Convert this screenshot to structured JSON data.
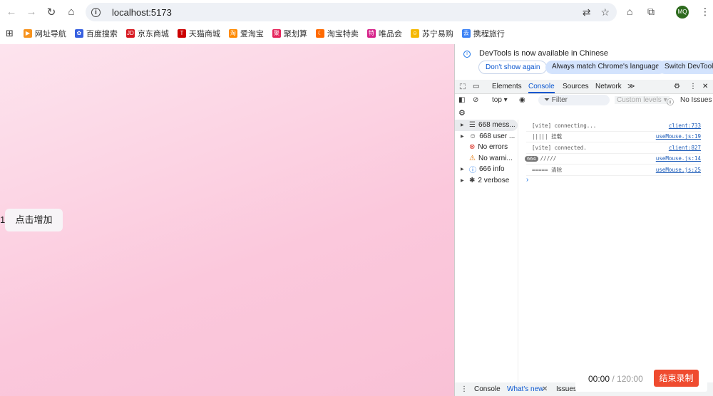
{
  "browser": {
    "url": "localhost:5173",
    "avatar": "MQ"
  },
  "bookmarks": [
    {
      "label": "网址导航",
      "color": "#f7931e",
      "glyph": "▶"
    },
    {
      "label": "百度搜索",
      "color": "#3760e0",
      "glyph": "✿"
    },
    {
      "label": "京东商城",
      "color": "#d71920",
      "glyph": "JD"
    },
    {
      "label": "天猫商城",
      "color": "#cc0000",
      "glyph": "T"
    },
    {
      "label": "爱淘宝",
      "color": "#ff8a00",
      "glyph": "淘"
    },
    {
      "label": "聚划算",
      "color": "#e5245b",
      "glyph": "聚"
    },
    {
      "label": "淘宝特卖",
      "color": "#ff6a00",
      "glyph": "☾"
    },
    {
      "label": "唯品会",
      "color": "#d6238a",
      "glyph": "特"
    },
    {
      "label": "苏宁易购",
      "color": "#f5b800",
      "glyph": "☺"
    },
    {
      "label": "携程旅行",
      "color": "#3b82f6",
      "glyph": "去"
    }
  ],
  "page": {
    "count": "1",
    "button": "点击增加"
  },
  "devtools": {
    "banner": {
      "text": "DevTools is now available in Chinese",
      "dont_show": "Don't show again",
      "always_match": "Always match Chrome's language",
      "switch": "Switch DevTools"
    },
    "tabs": [
      "Elements",
      "Console",
      "Sources",
      "Network"
    ],
    "more": "≫",
    "context": "top ▾",
    "filter": "Filter",
    "levels": "Custom levels ▾",
    "issues": "No Issues",
    "sidebar": [
      {
        "label": "668 mess...",
        "icon": "list-icon",
        "glyph": "☰"
      },
      {
        "label": "668 user ...",
        "icon": "user-icon",
        "glyph": "☺"
      },
      {
        "label": "No errors",
        "icon": "error-icon",
        "glyph": "⊗"
      },
      {
        "label": "No warni...",
        "icon": "warning-icon",
        "glyph": "⚠"
      },
      {
        "label": "666 info",
        "icon": "info-icon",
        "glyph": "ⓘ"
      },
      {
        "label": "2 verbose",
        "icon": "bug-icon",
        "glyph": "✱"
      }
    ],
    "logs": [
      {
        "text": "[vite] connecting...",
        "src": "client:733",
        "badge": null
      },
      {
        "text": "||||| 挂载",
        "src": "useMouse.js:19",
        "badge": null
      },
      {
        "text": "[vite] connected.",
        "src": "client:827",
        "badge": null
      },
      {
        "text": "/////",
        "src": "useMouse.js:14",
        "badge": "664"
      },
      {
        "text": "===== 清除",
        "src": "useMouse.js:25",
        "badge": null
      }
    ],
    "prompt": "›",
    "drawer_tabs": [
      "Console",
      "What's new",
      "Issues"
    ]
  },
  "recorder": {
    "elapsed": "00:00",
    "total": "/ 120:00",
    "stop": "结束录制"
  }
}
